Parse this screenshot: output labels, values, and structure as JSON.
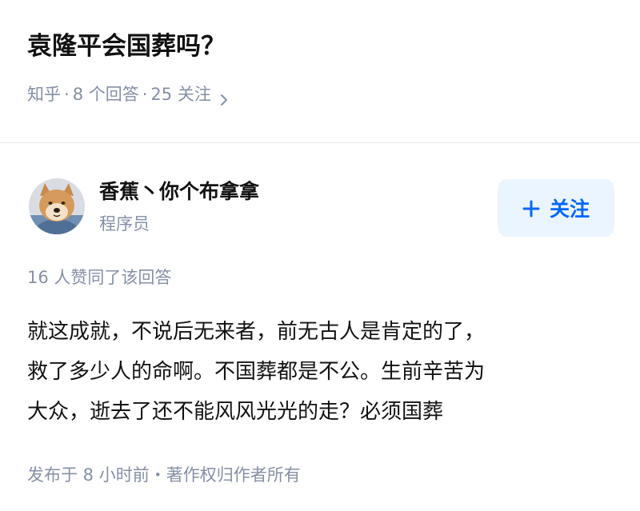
{
  "question": {
    "title": "袁隆平会国葬吗？",
    "source": "知乎",
    "answer_count": "8 个回答",
    "follower_count": "25 关注",
    "separator": "·"
  },
  "author": {
    "name": "香蕉丶你个布拿拿",
    "bio": "程序员",
    "avatar_icon": "shiba-dog-avatar"
  },
  "follow_button": {
    "label": "关注",
    "icon": "plus-icon",
    "color": "#0066ff",
    "background": "#ebf5ff"
  },
  "answer": {
    "vote_summary": "16 人赞同了该回答",
    "lines": [
      "就这成就，不说后无来者，前无古人是肯定的了，",
      "救了多少人的命啊。不国葬都是不公。生前辛苦为",
      "大众，逝去了还不能风风光光的走？必须国葬"
    ],
    "footer": "发布于 8 小时前・著作权归作者所有"
  },
  "colors": {
    "text_primary": "#121212",
    "text_secondary": "#8590a6",
    "divider": "#ebebeb"
  }
}
